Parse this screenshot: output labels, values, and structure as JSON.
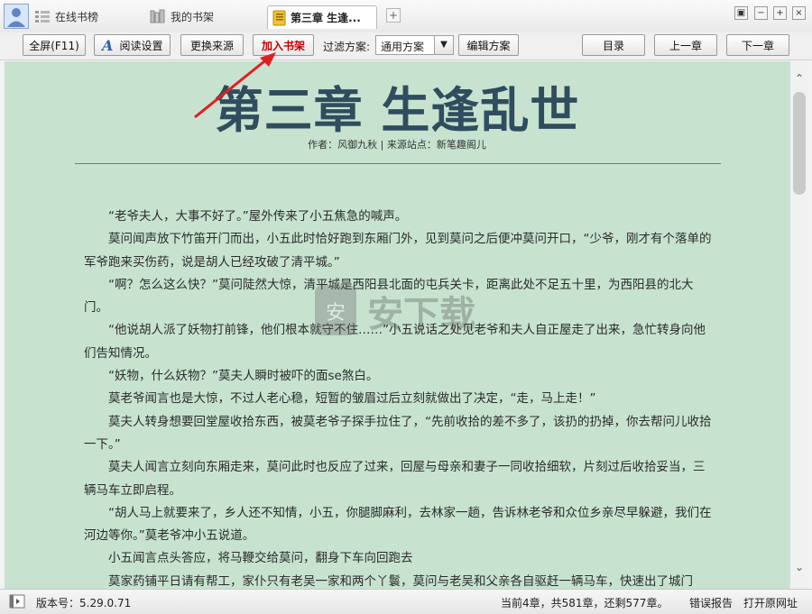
{
  "tabs": {
    "online_rank": "在线书榜",
    "my_shelf": "我的书架",
    "active_chapter": "第三章 生逢...",
    "add_tab": "+"
  },
  "window_controls": [
    "▣",
    "−",
    "+",
    "×"
  ],
  "toolbar": {
    "fullscreen": "全屏(F11)",
    "read_settings": "阅读设置",
    "change_source": "更换来源",
    "add_to_shelf": "加入书架",
    "filter_label": "过滤方案:",
    "filter_value": "通用方案",
    "edit_scheme": "编辑方案",
    "toc": "目录",
    "prev": "上一章",
    "next": "下一章"
  },
  "chapter": {
    "title": "第三章 生逢乱世",
    "meta": "作者：风御九秋 | 来源站点：新笔趣阁儿",
    "paragraphs": [
      "“老爷夫人，大事不好了。”屋外传来了小五焦急的喊声。",
      "莫问闻声放下竹笛开门而出，小五此时恰好跑到东厢门外，见到莫问之后便冲莫问开口，“少爷，刚才有个落单的军爷跑来买伤药，说是胡人已经攻破了清平城。”",
      "“啊？怎么这么快？”莫问陡然大惊，清平城是西阳县北面的屯兵关卡，距离此处不足五十里，为西阳县的北大门。",
      "“他说胡人派了妖物打前锋，他们根本就守不住……”小五说话之处见老爷和夫人自正屋走了出来，急忙转身向他们告知情况。",
      "“妖物，什么妖物？”莫夫人瞬时被吓的面se煞白。",
      "莫老爷闻言也是大惊，不过人老心稳，短暂的皱眉过后立刻就做出了决定，“走，马上走！”",
      "莫夫人转身想要回堂屋收拾东西，被莫老爷子探手拉住了，“先前收拾的差不多了，该扔的扔掉，你去帮问儿收拾一下。”",
      "莫夫人闻言立刻向东厢走来，莫问此时也反应了过来，回屋与母亲和妻子一同收拾细软，片刻过后收拾妥当，三辆马车立即启程。",
      "“胡人马上就要来了，乡人还不知情，小五，你腿脚麻利，去林家一趟，告诉林老爷和众位乡亲尽早躲避，我们在河边等你。”莫老爷冲小五说道。",
      "小五闻言点头答应，将马鞭交给莫问，翻身下车向回跑去",
      "莫家药铺平日请有帮工，家仆只有老吴一家和两个丫鬟，莫问与老吴和父亲各自驱赶一辆马车，快速出了城门"
    ]
  },
  "watermark": {
    "text": "安下载",
    "badge": "安"
  },
  "status": {
    "version": "版本号：5.29.0.71",
    "progress": "当前4章，共581章，还剩577章。",
    "report": "错误报告",
    "open_source": "打开原网址"
  },
  "colors": {
    "reader_bg": "#c7e3d0",
    "title_color": "#2f4d5e",
    "accent_red": "#c00000"
  }
}
